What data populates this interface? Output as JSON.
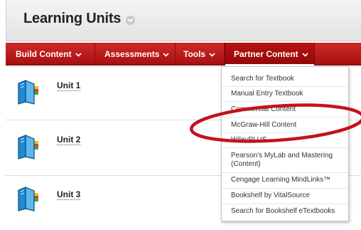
{
  "page": {
    "title": "Learning Units"
  },
  "nav": {
    "items": [
      {
        "label": "Build Content"
      },
      {
        "label": "Assessments"
      },
      {
        "label": "Tools"
      },
      {
        "label": "Partner Content"
      }
    ]
  },
  "units": [
    {
      "label": "Unit 1"
    },
    {
      "label": "Unit 2"
    },
    {
      "label": "Unit 3"
    }
  ],
  "dropdown": {
    "items": [
      {
        "label": "Search for Textbook"
      },
      {
        "label": "Manual Entry Textbook"
      },
      {
        "label": "Commercial Content"
      },
      {
        "label": "McGraw-Hill Content"
      },
      {
        "label": "WileyPLUS"
      },
      {
        "label": "Pearson's MyLab and Mastering (Content)"
      },
      {
        "label": "Cengage Learning MindLinks™"
      },
      {
        "label": "Bookshelf by VitalSource"
      },
      {
        "label": "Search for Bookshelf eTextbooks"
      }
    ]
  },
  "colors": {
    "nav_red": "#c21b1b",
    "highlight_ring": "#c4121c",
    "icon_blue": "#1f8ad6"
  }
}
